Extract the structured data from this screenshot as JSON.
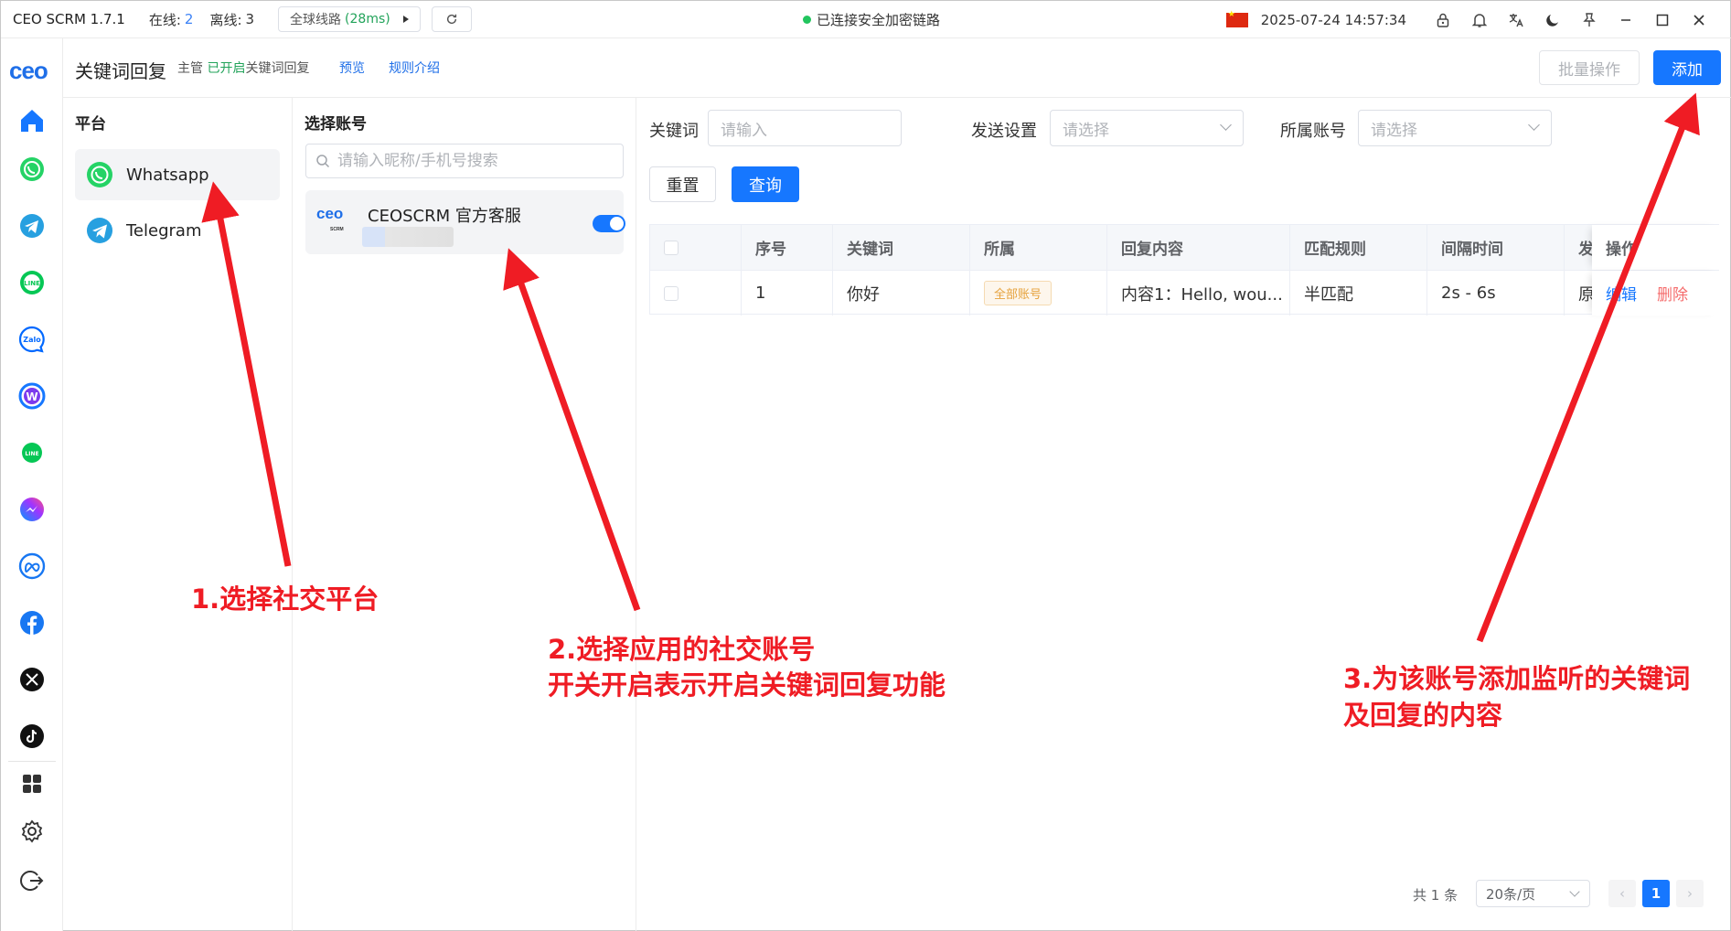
{
  "titlebar": {
    "app_name": "CEO SCRM 1.7.1",
    "online_label": "在线:",
    "online_count": "2",
    "offline_label": "离线:",
    "offline_count": "3",
    "route_label": "全球线路",
    "route_latency": "(28ms)",
    "connection_status": "已连接安全加密链路",
    "datetime": "2025-07-24 14:57:34"
  },
  "nav": {
    "logo": "ceo",
    "icons": [
      "home-icon",
      "whatsapp-icon",
      "telegram-icon",
      "line-icon",
      "zalo-icon",
      "w-app-icon",
      "line-green-icon",
      "messenger-icon",
      "meta-icon",
      "facebook-icon",
      "x-icon",
      "tiktok-icon",
      "apps-icon",
      "settings-icon",
      "logout-icon"
    ]
  },
  "header": {
    "title": "关键词回复",
    "sub_prefix": "主管",
    "sub_status": "已开启",
    "sub_suffix": "关键词回复",
    "link_preview": "预览",
    "link_rules": "规则介绍",
    "batch_button": "批量操作",
    "add_button": "添加"
  },
  "platforms": {
    "title": "平台",
    "items": [
      {
        "label": "Whatsapp",
        "icon": "whatsapp-icon",
        "active": true
      },
      {
        "label": "Telegram",
        "icon": "telegram-icon",
        "active": false
      }
    ]
  },
  "accounts": {
    "title": "选择账号",
    "search_placeholder": "请输入昵称/手机号搜索",
    "items": [
      {
        "avatar_text": "ceo",
        "avatar_sub": "SCRM",
        "name": "CEOSCRM 官方客服",
        "enabled": true
      }
    ]
  },
  "filters": {
    "keyword_label": "关键词",
    "keyword_placeholder": "请输入",
    "send_label": "发送设置",
    "send_placeholder": "请选择",
    "account_label": "所属账号",
    "account_placeholder": "请选择",
    "reset_button": "重置",
    "query_button": "查询"
  },
  "table": {
    "headers": [
      "序号",
      "关键词",
      "所属",
      "回复内容",
      "匹配规则",
      "间隔时间",
      "发",
      "操作"
    ],
    "rows": [
      {
        "index": "1",
        "keyword": "你好",
        "scope": "全部账号",
        "content": "内容1：Hello, wou...",
        "match": "半匹配",
        "interval": "2s - 6s",
        "send": "原",
        "edit": "编辑",
        "delete": "删除"
      }
    ]
  },
  "pagination": {
    "total": "共 1 条",
    "page_size": "20条/页",
    "current_page": "1"
  },
  "annotations": {
    "step1": "1.选择社交平台",
    "step2_line1": "2.选择应用的社交账号",
    "step2_line2": "开关开启表示开启关键词回复功能",
    "step3_line1": "3.为该账号添加监听的关键词",
    "step3_line2": "及回复的内容"
  },
  "colors": {
    "primary": "#1677ff",
    "success": "#22a35a",
    "annotation": "#ef1c24",
    "tag_warning": "#e6a23c",
    "danger": "#f56c6c"
  }
}
